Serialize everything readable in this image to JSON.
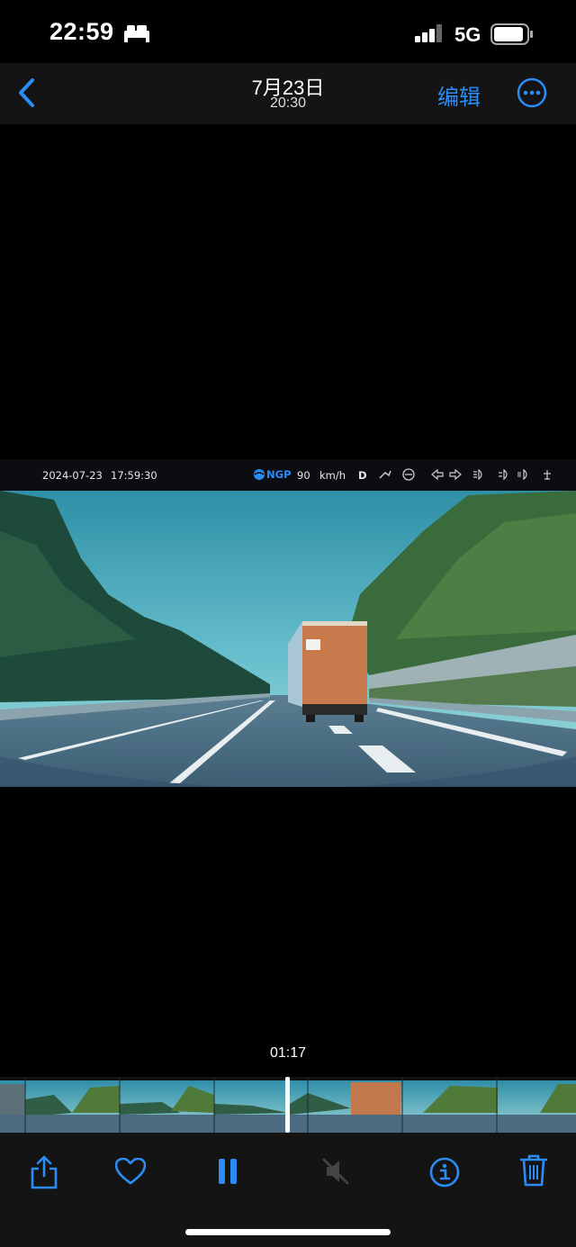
{
  "status_bar": {
    "time": "22:59",
    "network": "5G"
  },
  "nav": {
    "date": "7月23日",
    "time": "20:30",
    "edit_label": "编辑"
  },
  "video": {
    "osd": {
      "date": "2024-07-23",
      "clock": "17:59:30",
      "mode": "NGP",
      "speed": "90",
      "speed_unit": "km/h",
      "gear": "D"
    }
  },
  "playback": {
    "current_time": "01:17"
  },
  "colors": {
    "accent": "#2b8cf5",
    "toolbar_bg": "#141414"
  },
  "icons": [
    "back-icon",
    "more-icon",
    "share-icon",
    "heart-icon",
    "pause-icon",
    "mute-icon",
    "info-icon",
    "trash-icon"
  ]
}
